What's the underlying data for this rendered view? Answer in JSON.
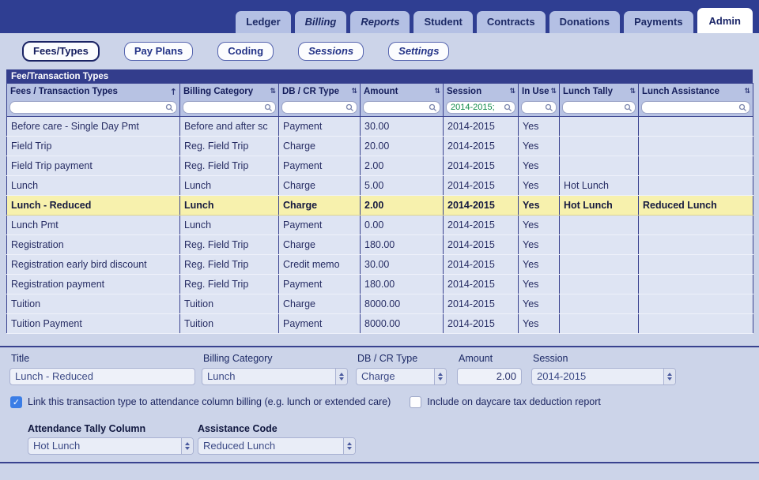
{
  "nav": {
    "tabs": [
      {
        "label": "Ledger"
      },
      {
        "label": "Billing"
      },
      {
        "label": "Reports"
      },
      {
        "label": "Student"
      },
      {
        "label": "Contracts"
      },
      {
        "label": "Donations"
      },
      {
        "label": "Payments"
      },
      {
        "label": "Admin"
      }
    ]
  },
  "subnav": {
    "buttons": [
      {
        "label": "Fees/Types"
      },
      {
        "label": "Pay Plans"
      },
      {
        "label": "Coding"
      },
      {
        "label": "Sessions"
      },
      {
        "label": "Settings"
      }
    ]
  },
  "section_title": "Fee/Transaction Types",
  "table": {
    "columns": [
      {
        "label": "Fees / Transaction Types",
        "sort": "asc",
        "filter": ""
      },
      {
        "label": "Billing Category",
        "sort": "both",
        "filter": ""
      },
      {
        "label": "DB / CR Type",
        "sort": "both",
        "filter": ""
      },
      {
        "label": "Amount",
        "sort": "both",
        "filter": ""
      },
      {
        "label": "Session",
        "sort": "both",
        "filter": "2014-2015;"
      },
      {
        "label": "In Use",
        "sort": "both",
        "filter": ""
      },
      {
        "label": "Lunch Tally",
        "sort": "both",
        "filter": ""
      },
      {
        "label": "Lunch Assistance",
        "sort": "both",
        "filter": ""
      }
    ],
    "rows": [
      [
        "Before care - Single Day Pmt",
        "Before and after sc",
        "Payment",
        "30.00",
        "2014-2015",
        "Yes",
        "",
        ""
      ],
      [
        "Field Trip",
        "Reg. Field Trip",
        "Charge",
        "20.00",
        "2014-2015",
        "Yes",
        "",
        ""
      ],
      [
        "Field Trip payment",
        "Reg. Field Trip",
        "Payment",
        "2.00",
        "2014-2015",
        "Yes",
        "",
        ""
      ],
      [
        "Lunch",
        "Lunch",
        "Charge",
        "5.00",
        "2014-2015",
        "Yes",
        "Hot Lunch",
        ""
      ],
      [
        "Lunch - Reduced",
        "Lunch",
        "Charge",
        "2.00",
        "2014-2015",
        "Yes",
        "Hot Lunch",
        "Reduced Lunch"
      ],
      [
        "Lunch Pmt",
        "Lunch",
        "Payment",
        "0.00",
        "2014-2015",
        "Yes",
        "",
        ""
      ],
      [
        "Registration",
        "Reg. Field Trip",
        "Charge",
        "180.00",
        "2014-2015",
        "Yes",
        "",
        ""
      ],
      [
        "Registration early bird discount",
        "Reg. Field Trip",
        "Credit memo",
        "30.00",
        "2014-2015",
        "Yes",
        "",
        ""
      ],
      [
        "Registration payment",
        "Reg. Field Trip",
        "Payment",
        "180.00",
        "2014-2015",
        "Yes",
        "",
        ""
      ],
      [
        "Tuition",
        "Tuition",
        "Charge",
        "8000.00",
        "2014-2015",
        "Yes",
        "",
        ""
      ],
      [
        "Tuition Payment",
        "Tuition",
        "Payment",
        "8000.00",
        "2014-2015",
        "Yes",
        "",
        ""
      ]
    ],
    "selected_row": 4
  },
  "form": {
    "title_label": "Title",
    "title_value": "Lunch - Reduced",
    "billing_category_label": "Billing Category",
    "billing_category_value": "Lunch",
    "db_cr_label": "DB / CR Type",
    "db_cr_value": "Charge",
    "amount_label": "Amount",
    "amount_value": "2.00",
    "session_label": "Session",
    "session_value": "2014-2015",
    "link_checkbox_label": "Link this transaction type to attendance column billing (e.g. lunch or extended care)",
    "daycare_checkbox_label": "Include on daycare tax deduction report",
    "tally_label": "Attendance Tally Column",
    "tally_value": "Hot Lunch",
    "assistance_label": "Assistance Code",
    "assistance_value": "Reduced Lunch"
  },
  "colors": {
    "navbar_bg": "#2f3e92",
    "page_bg": "#ccd4e9",
    "section_bar_bg": "#333d8c",
    "header_row_bg": "#b7c2e3",
    "row_bg": "#dee4f3",
    "selected_row_bg": "#f7f1ad",
    "grid_line": "#39428f",
    "filter_text_green": "#0f8a47",
    "checkbox_blue": "#3b7de6",
    "tab_inactive_bg": "#b4c0e4",
    "text_navy": "#1d2a66"
  }
}
